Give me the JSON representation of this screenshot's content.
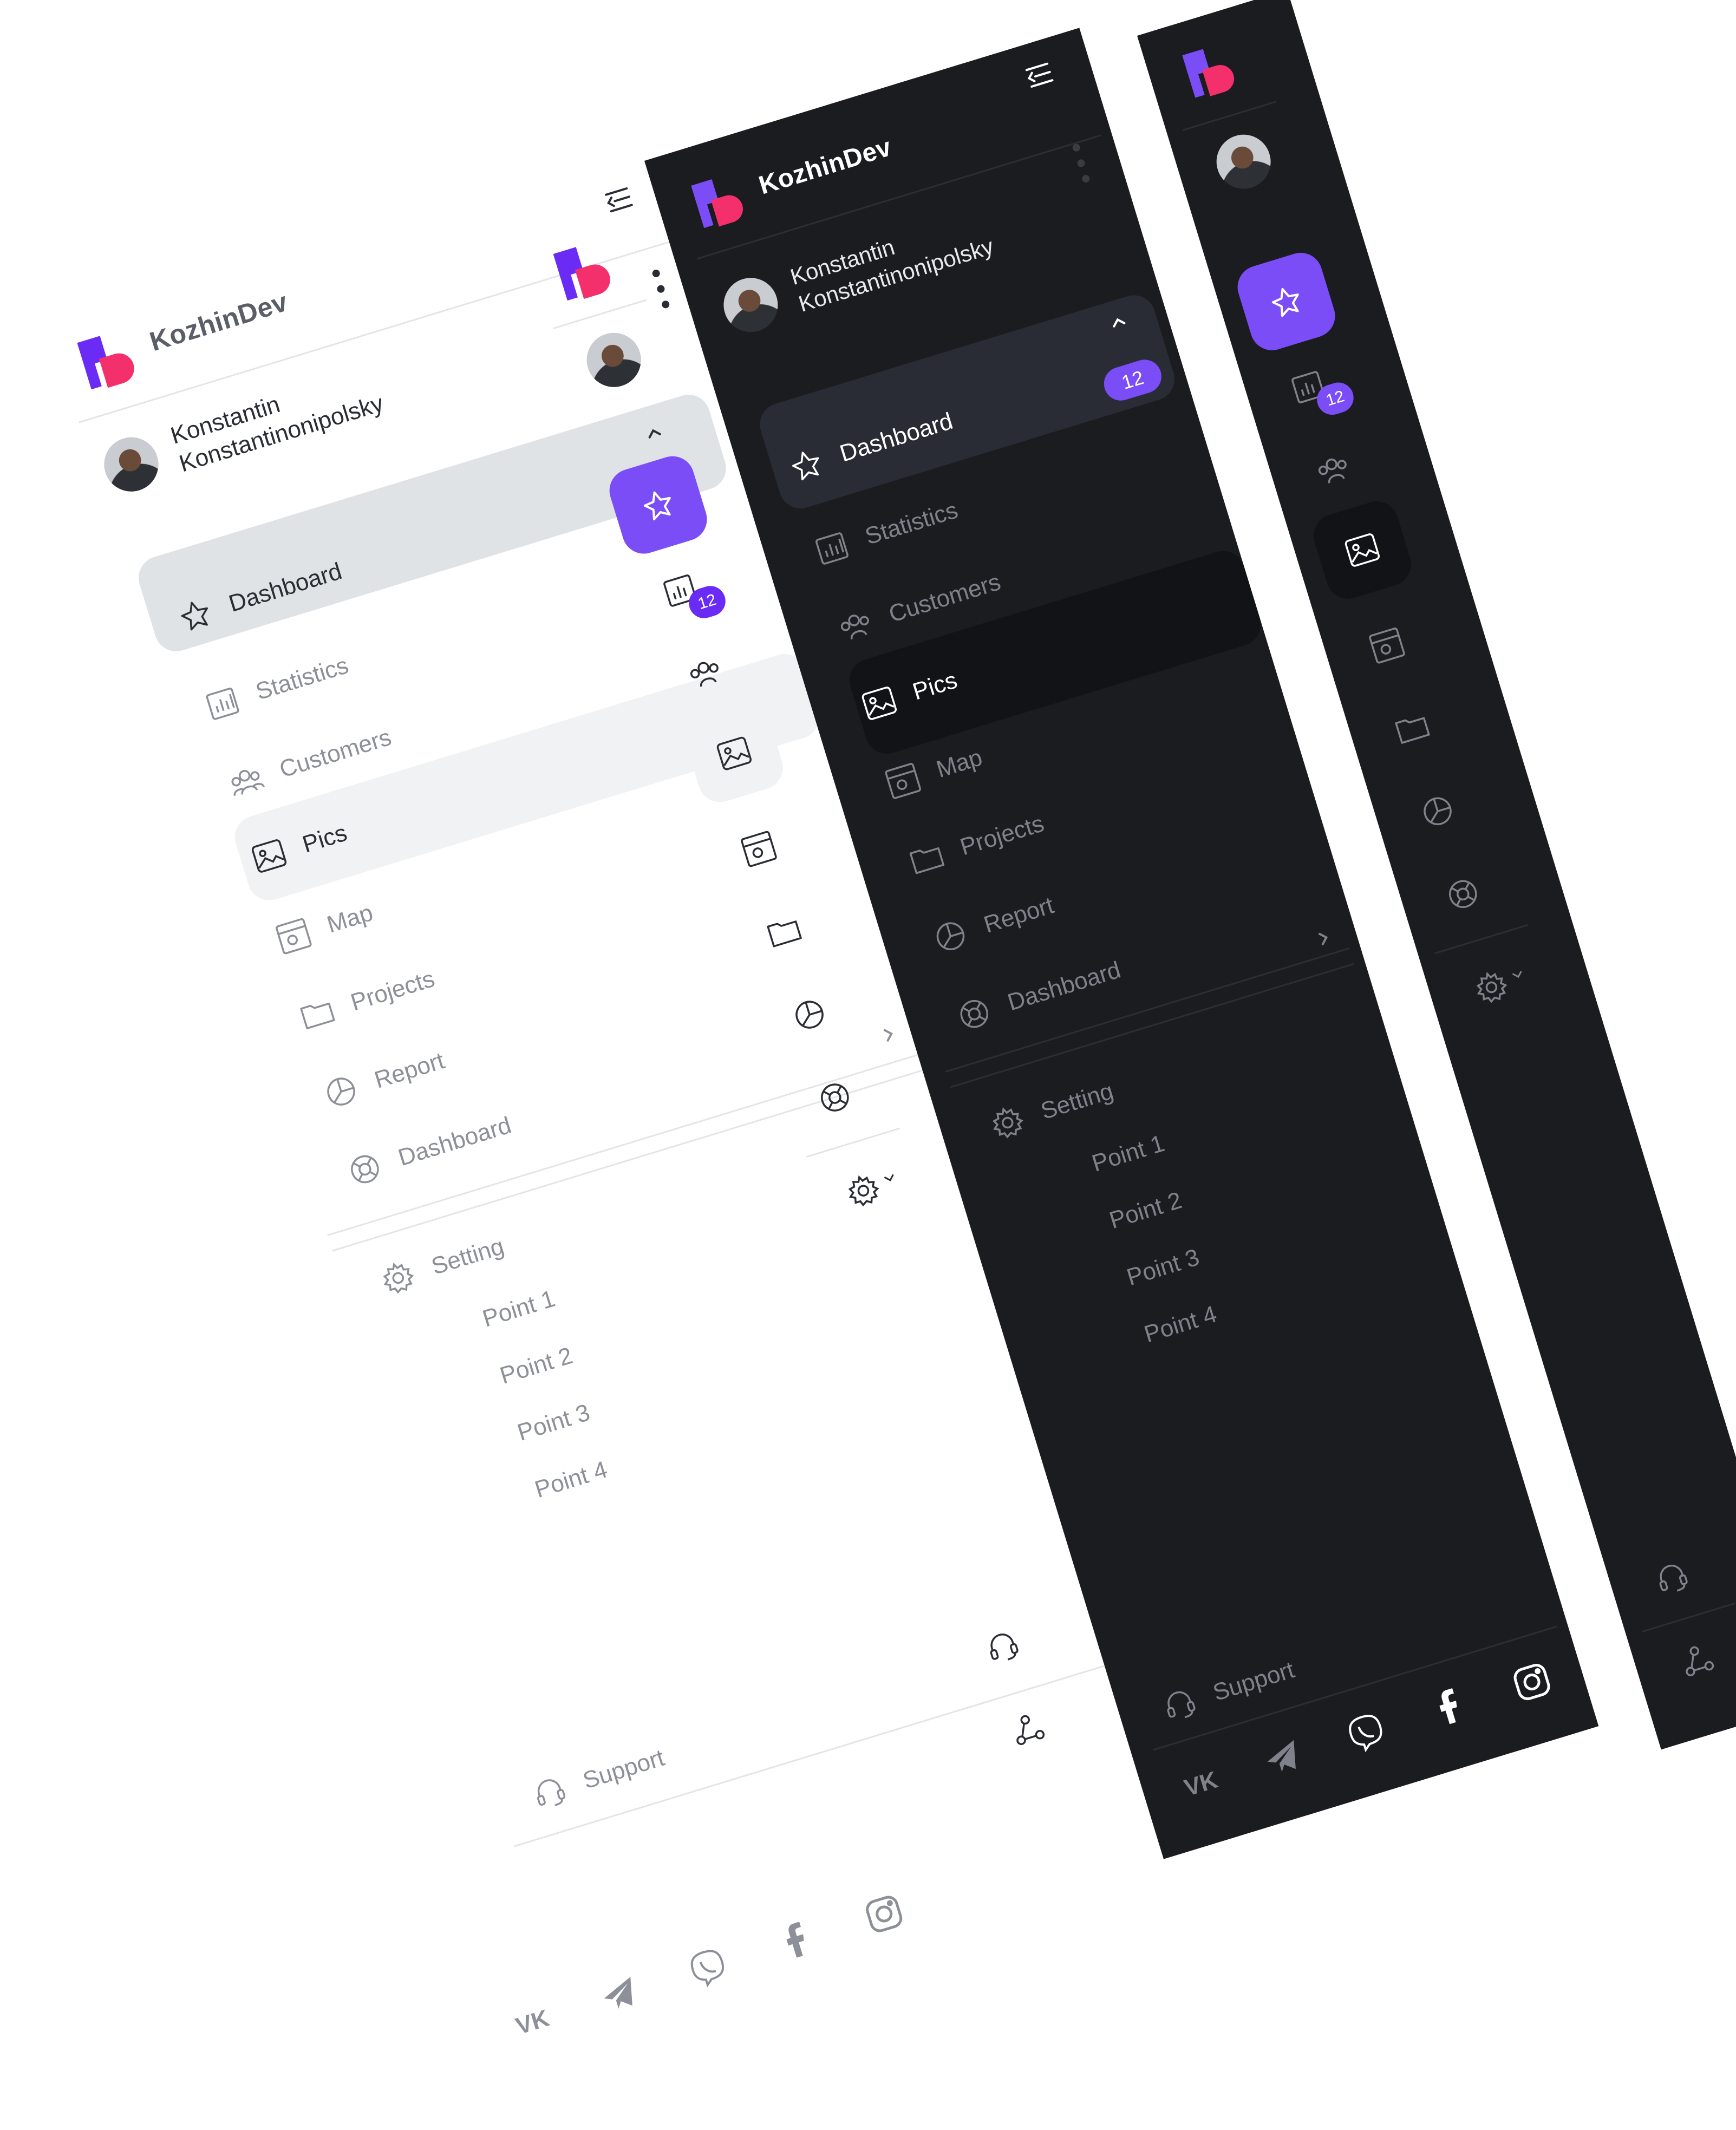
{
  "brand": {
    "name": "KozhinDev"
  },
  "user": {
    "first_name": "Konstantin",
    "last_name": "Konstantinonipolsky"
  },
  "menu": {
    "items": [
      {
        "label": "Dashboard",
        "icon": "star-icon"
      },
      {
        "label": "Statistics",
        "icon": "chart-icon"
      },
      {
        "label": "Customers",
        "icon": "users-icon"
      },
      {
        "label": "Pics",
        "icon": "image-icon"
      },
      {
        "label": "Map",
        "icon": "map-icon"
      },
      {
        "label": "Projects",
        "icon": "folder-icon"
      },
      {
        "label": "Report",
        "icon": "pie-icon"
      },
      {
        "label": "Dashboard",
        "icon": "lifebuoy-icon"
      }
    ],
    "badge_count": "12"
  },
  "settings": {
    "label": "Setting",
    "points": [
      "Point 1",
      "Point 2",
      "Point 3",
      "Point 4"
    ]
  },
  "footer": {
    "support_label": "Support",
    "social": [
      "vk-icon",
      "telegram-icon",
      "viber-icon",
      "facebook-icon",
      "instagram-icon"
    ]
  },
  "colors": {
    "accent": "#6a2cf5",
    "accent_light": "#7b4df6",
    "logo_blue": "#6a2cf5",
    "logo_pink": "#f3306b",
    "light_active_bg": "#dfe3e6",
    "light_hover_bg": "#f0f2f4",
    "dark_bg": "#1b1c20",
    "dark_active_bg": "#2a2c35",
    "dark_hover_bg": "#121316"
  }
}
